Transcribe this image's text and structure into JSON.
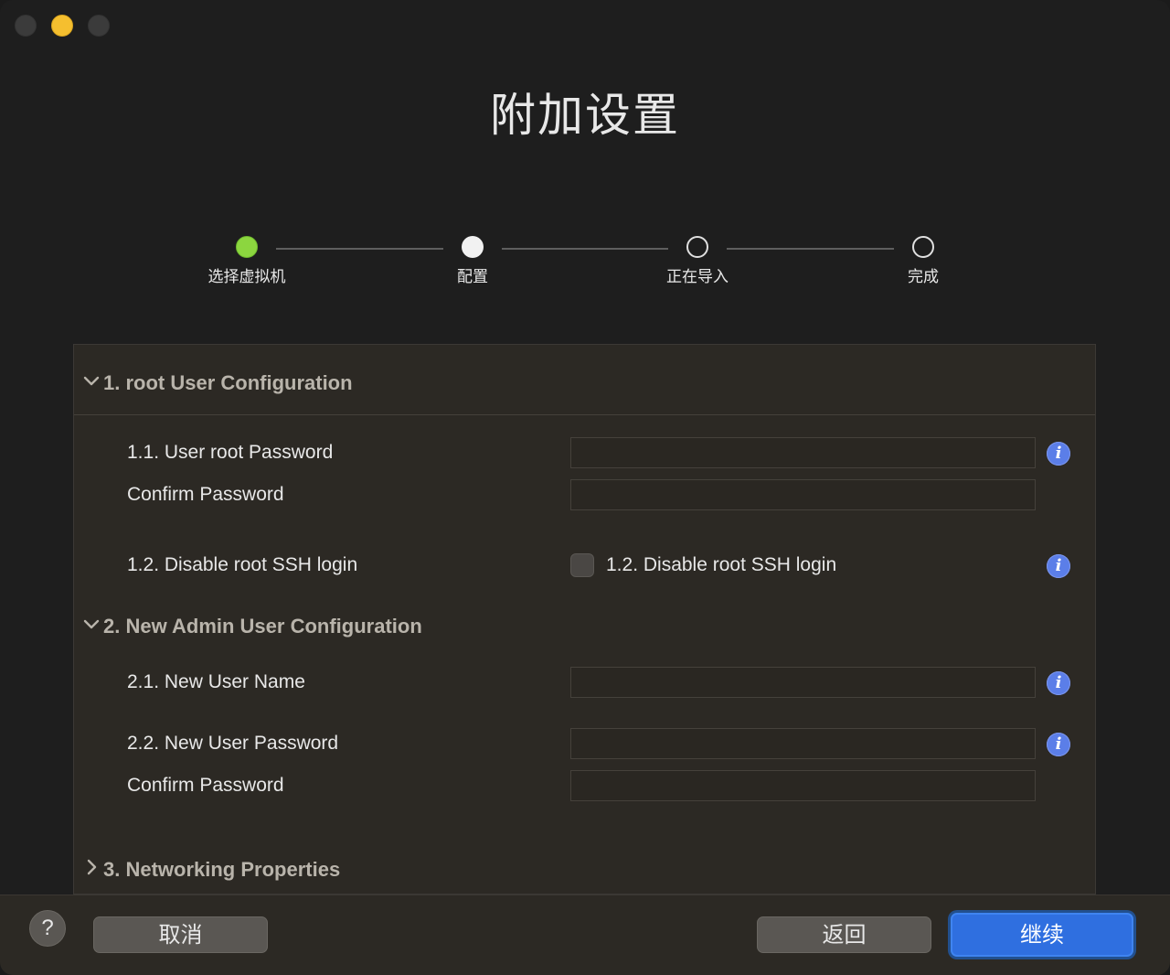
{
  "window": {
    "title": "附加设置"
  },
  "steps": [
    {
      "label": "选择虚拟机",
      "state": "done"
    },
    {
      "label": "配置",
      "state": "current"
    },
    {
      "label": "正在导入",
      "state": "todo"
    },
    {
      "label": "完成",
      "state": "todo"
    }
  ],
  "sections": {
    "root": {
      "header": "1. root User Configuration",
      "expanded": true,
      "password_label": "1.1. User root Password",
      "password_value": "",
      "confirm_label": "Confirm Password",
      "confirm_value": "",
      "ssh_label": "1.2. Disable root SSH login",
      "ssh_checkbox_label": "1.2. Disable root SSH login",
      "ssh_checked": false
    },
    "admin": {
      "header": "2. New Admin User Configuration",
      "expanded": true,
      "name_label": "2.1. New User Name",
      "name_value": "",
      "password_label": "2.2. New User Password",
      "password_value": "",
      "confirm_label": "Confirm Password",
      "confirm_value": ""
    },
    "network": {
      "header": "3. Networking Properties",
      "expanded": false
    }
  },
  "footer": {
    "help": "?",
    "cancel": "取消",
    "back": "返回",
    "continue": "继续"
  },
  "colors": {
    "accent": "#2f6fe0",
    "step_done": "#8cd63f",
    "info": "#5b7ee8"
  }
}
